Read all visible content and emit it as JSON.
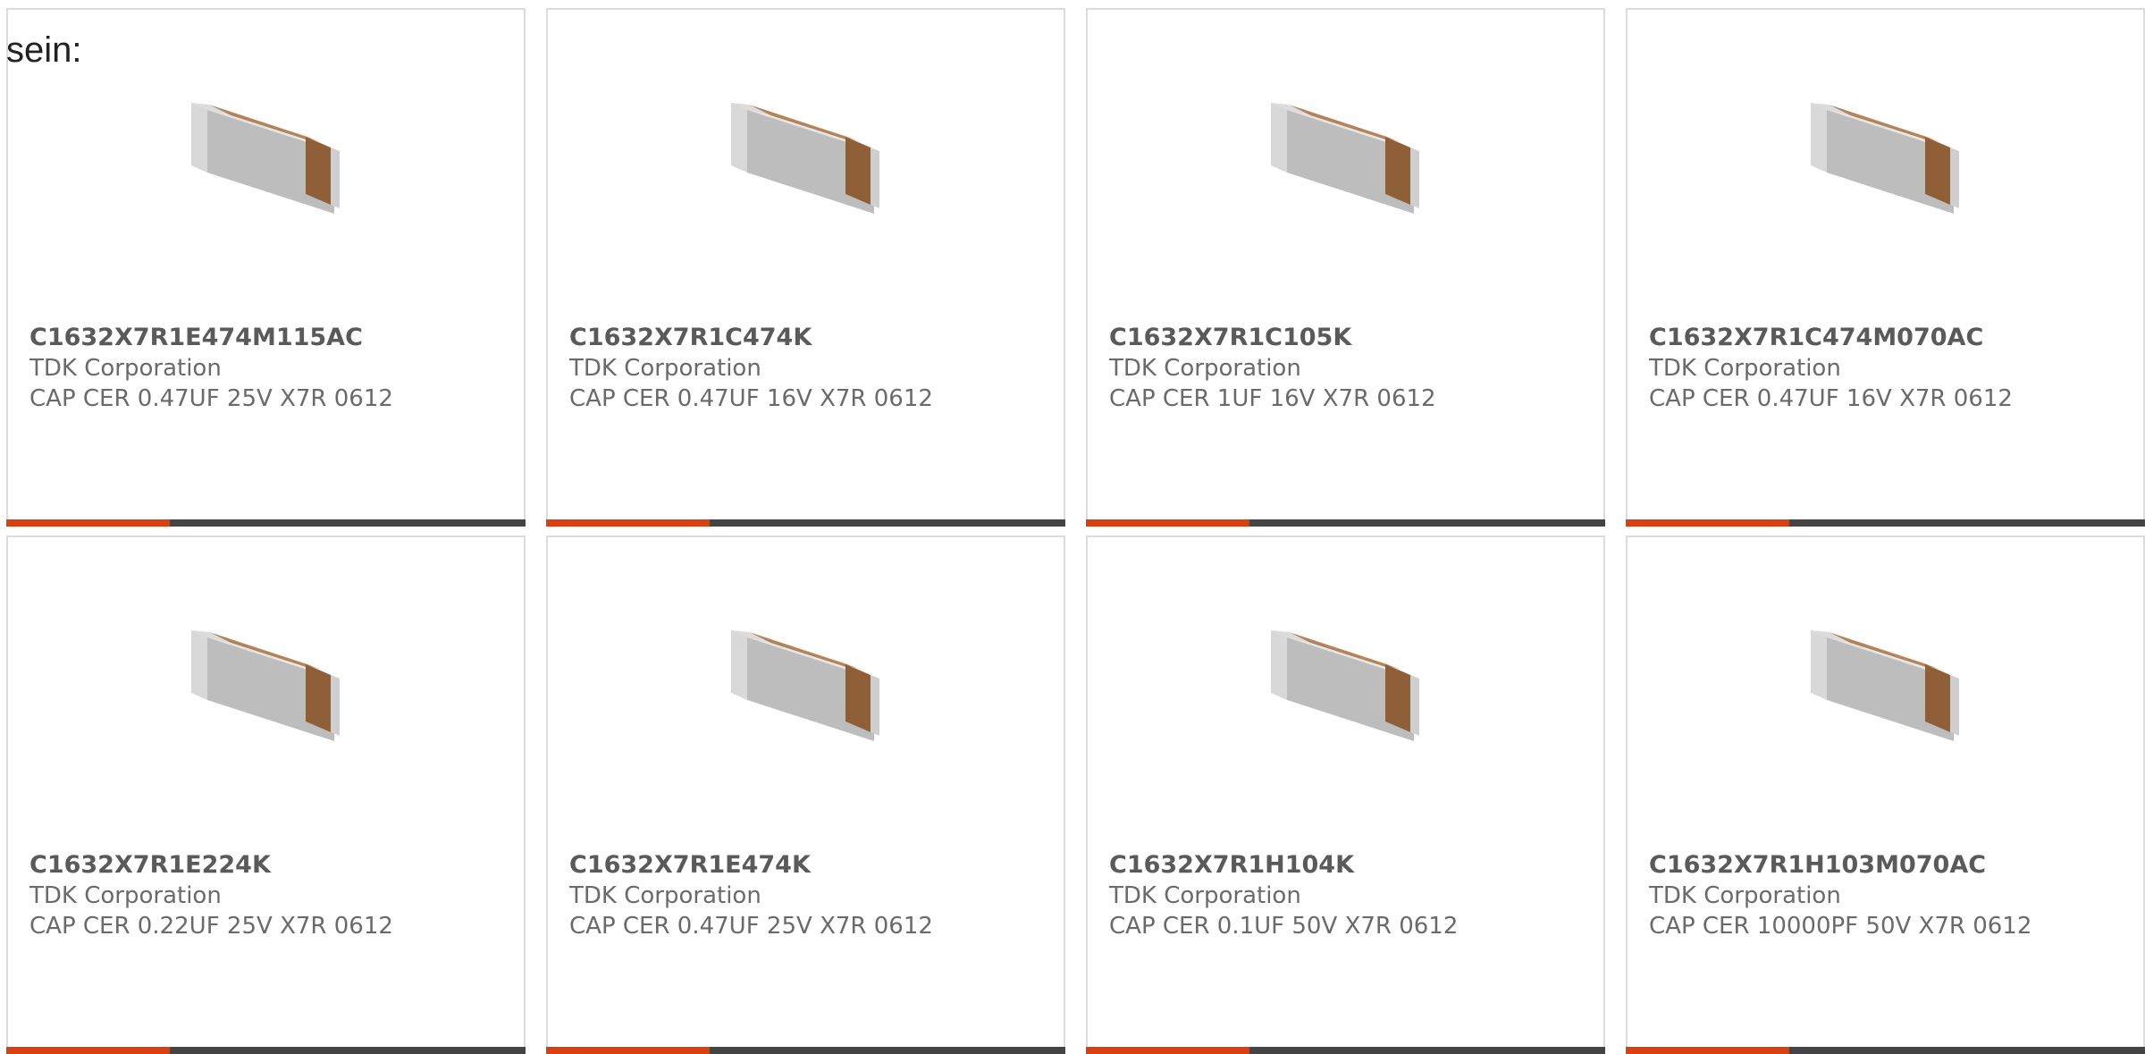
{
  "intro_text": "sein:",
  "colors": {
    "accent": "#d94010",
    "bar": "#444444",
    "border": "#dcdcdc",
    "ceramic": "#a87548",
    "terminal": "#c9c9c9"
  },
  "products": [
    {
      "part_number": "C1632X7R1E474M115AC",
      "manufacturer": "TDK Corporation",
      "description": "CAP CER 0.47UF 25V X7R 0612",
      "image_icon": "ceramic-capacitor-icon"
    },
    {
      "part_number": "C1632X7R1C474K",
      "manufacturer": "TDK Corporation",
      "description": "CAP CER 0.47UF 16V X7R 0612",
      "image_icon": "ceramic-capacitor-icon"
    },
    {
      "part_number": "C1632X7R1C105K",
      "manufacturer": "TDK Corporation",
      "description": "CAP CER 1UF 16V X7R 0612",
      "image_icon": "ceramic-capacitor-icon"
    },
    {
      "part_number": "C1632X7R1C474M070AC",
      "manufacturer": "TDK Corporation",
      "description": "CAP CER 0.47UF 16V X7R 0612",
      "image_icon": "ceramic-capacitor-icon"
    },
    {
      "part_number": "C1632X7R1E224K",
      "manufacturer": "TDK Corporation",
      "description": "CAP CER 0.22UF 25V X7R 0612",
      "image_icon": "ceramic-capacitor-icon"
    },
    {
      "part_number": "C1632X7R1E474K",
      "manufacturer": "TDK Corporation",
      "description": "CAP CER 0.47UF 25V X7R 0612",
      "image_icon": "ceramic-capacitor-icon"
    },
    {
      "part_number": "C1632X7R1H104K",
      "manufacturer": "TDK Corporation",
      "description": "CAP CER 0.1UF 50V X7R 0612",
      "image_icon": "ceramic-capacitor-icon"
    },
    {
      "part_number": "C1632X7R1H103M070AC",
      "manufacturer": "TDK Corporation",
      "description": "CAP CER 10000PF 50V X7R 0612",
      "image_icon": "ceramic-capacitor-icon"
    }
  ]
}
